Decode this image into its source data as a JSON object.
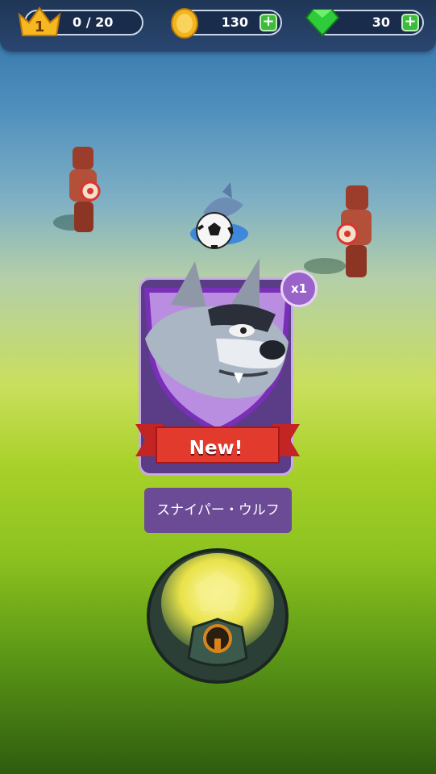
{
  "hud": {
    "trophy_level": "1",
    "trophy_progress": "0 / 20",
    "coins": "130",
    "gems": "30",
    "add_symbol": "+"
  },
  "reward": {
    "count_badge": "x1",
    "new_label": "New!",
    "character_name": "スナイパー・ウルフ"
  },
  "colors": {
    "hud_bg": "#1f3656",
    "coin": "#f2b51d",
    "gem": "#2ecb3a",
    "card": "#5b3c87",
    "ribbon": "#e03030"
  }
}
